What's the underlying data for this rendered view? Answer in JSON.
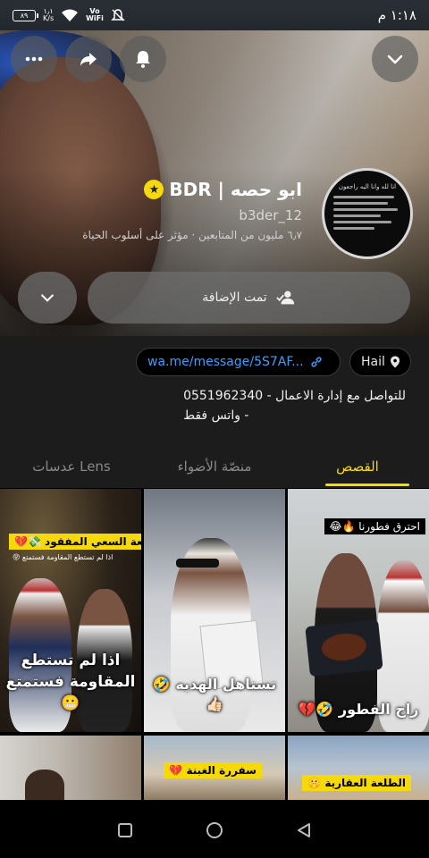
{
  "status_bar": {
    "time": "١:١٨ م",
    "battery": "٨٩",
    "network_speed": "١٫١\nK/s",
    "vo_label": "Vo\nWiFi"
  },
  "hero": {
    "profile_name": "ابو حصه | BDR",
    "username": "b3der_12",
    "tagline": "٦٫٧ مليون من المتابعين · مؤثر على أسلوب الحياة",
    "added_label": "تمت الإضافة",
    "avatar_text_line1": "انا لله وانا اليه راجعون"
  },
  "info": {
    "link": "wa.me/message/5S7AF...",
    "location": "Hail",
    "bio_line1": "للتواصل مع إدارة الاعمال - 0551962340",
    "bio_line2": "- واتس فقط"
  },
  "tabs": [
    {
      "label": "القصص",
      "active": true
    },
    {
      "label": "منصّة الأضواء",
      "active": false
    },
    {
      "label": "عدسات Lens",
      "active": false
    }
  ],
  "stories": [
    {
      "caption": "احترق فطورنا 🔥😂",
      "title": "راح الفطور 🤣💔"
    },
    {
      "caption": "",
      "title": "تستاهل الهديه 🤣\n👍🏻"
    },
    {
      "caption": "طلعة السعي المفقود 💸💔",
      "subcaption": "اذا لم تستطع المقاومة فستمتع 😝",
      "title": "اذا لم تستطع\nالمقاومة فستمتع\n😬"
    },
    {
      "caption": "الطلعة العقارية 🤫",
      "title": ""
    },
    {
      "caption": "سفررة الغبنة 💔",
      "title": ""
    },
    {
      "caption": "",
      "title": ""
    }
  ],
  "colors": {
    "accent": "#f5d90b",
    "link": "#3aa0ff",
    "background": "#000000",
    "panel": "#1c1c1c"
  }
}
